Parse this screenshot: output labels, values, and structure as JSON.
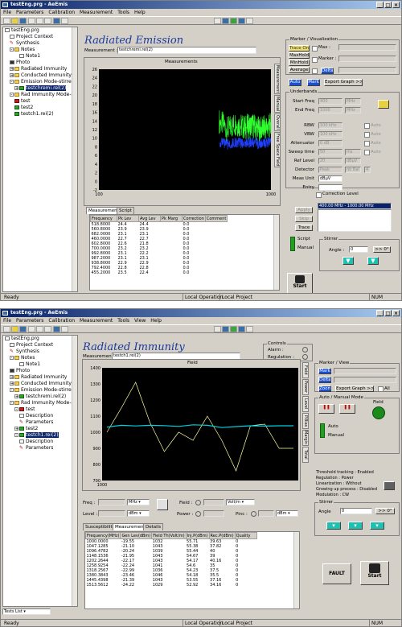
{
  "w1": {
    "title": "testEng.prg - AeEmis",
    "menu": [
      "File",
      "Parameters",
      "Calibration",
      "Measurement",
      "Tools",
      "Help"
    ],
    "tree": [
      {
        "label": "testEng.prg",
        "icon": "doc",
        "indent": 0,
        "pm": ""
      },
      {
        "label": "Project Context",
        "icon": "doc",
        "indent": 1,
        "pm": ""
      },
      {
        "label": "Synthesis",
        "icon": "pin",
        "indent": 1,
        "pm": ""
      },
      {
        "label": "Notes",
        "icon": "folder",
        "indent": 1,
        "pm": "-"
      },
      {
        "label": "Note1",
        "icon": "doc",
        "indent": 3,
        "pm": ""
      },
      {
        "label": "Photo",
        "icon": "photo",
        "indent": 1,
        "pm": ""
      },
      {
        "label": "Radiated Immunity",
        "icon": "folder",
        "indent": 1,
        "pm": "+"
      },
      {
        "label": "Conducted Immunity",
        "icon": "folder",
        "indent": 1,
        "pm": "+"
      },
      {
        "label": "Emission Mode-stirred Ch",
        "icon": "folder",
        "indent": 1,
        "pm": "-"
      },
      {
        "label": "testchremi.rel(2)",
        "icon": "green",
        "indent": 2,
        "pm": "+",
        "selected": true
      },
      {
        "label": "Rad Immunity Mode-stirred C",
        "icon": "folder",
        "indent": 1,
        "pm": "-"
      },
      {
        "label": "test",
        "icon": "red",
        "indent": 2,
        "pm": ""
      },
      {
        "label": "test2",
        "icon": "green",
        "indent": 2,
        "pm": ""
      },
      {
        "label": "testch1.rei(2)",
        "icon": "green",
        "indent": 2,
        "pm": ""
      }
    ],
    "header": "Radiated Emission",
    "measurement_label": "Measurement :",
    "measurement_value": "testchremi.rel(2)",
    "plot_title": "Measurements",
    "y_ticks": [
      "26",
      "24",
      "22",
      "20",
      "18",
      "16",
      "14",
      "12",
      "10",
      "8",
      "6",
      "4",
      "2",
      "0",
      "-2"
    ],
    "x_ticks": [
      "100",
      "1000"
    ],
    "chart_data": {
      "type": "line",
      "x_scale": "log",
      "xlim": [
        100,
        1000
      ],
      "ylim": [
        -2,
        26
      ],
      "series": [
        {
          "color": "#30ff30",
          "x": [
            500,
            560,
            620,
            700,
            780,
            860,
            940,
            1000
          ],
          "y": [
            14,
            12,
            13.5,
            12.5,
            13,
            12,
            12.5,
            13
          ]
        },
        {
          "color": "#2040ff",
          "x": [
            500,
            560,
            620,
            700,
            780,
            860,
            940,
            1000
          ],
          "y": [
            9,
            8.5,
            9,
            8.8,
            9.2,
            8.6,
            9,
            9.1
          ]
        }
      ]
    },
    "vtabs": [
      "Measurement",
      "Manual",
      "Overall",
      "Free Space Field"
    ],
    "tabs": [
      "Measurement",
      "Script"
    ],
    "table_headers": [
      "Frequency",
      "Pk Lev",
      "Avg Lev",
      "Pk Marg",
      "Correction",
      "Comment"
    ],
    "table_rows": [
      [
        "518.8000",
        "24.4",
        "24.4",
        "",
        "0.0",
        ""
      ],
      [
        "560.8000",
        "23.9",
        "23.9",
        "",
        "0.0",
        ""
      ],
      [
        "682.0000",
        "23.1",
        "23.1",
        "",
        "0.0",
        ""
      ],
      [
        "460.0000",
        "22.7",
        "22.7",
        "",
        "0.0",
        ""
      ],
      [
        "602.8000",
        "22.6",
        "21.8",
        "",
        "0.0",
        ""
      ],
      [
        "700.0000",
        "23.2",
        "23.2",
        "",
        "0.0",
        ""
      ],
      [
        "992.8000",
        "23.1",
        "22.2",
        "",
        "0.0",
        ""
      ],
      [
        "987.2000",
        "23.1",
        "23.1",
        "",
        "0.0",
        ""
      ],
      [
        "938.8000",
        "22.9",
        "22.9",
        "",
        "0.0",
        ""
      ],
      [
        "792.4000",
        "22.8",
        "22.8",
        "",
        "0.0",
        ""
      ],
      [
        "455.2000",
        "23.5",
        "22.4",
        "",
        "0.0",
        ""
      ]
    ],
    "marker_group": "Marker / Visualization",
    "trace_on": "Trace On",
    "maxhold": "MaxHold",
    "minhold": "MinHold",
    "average": "Average",
    "delta": "Delta",
    "max_lbl": "Max :",
    "marker_lbl": "Marker :",
    "auto_btn": "Auto",
    "mark_btn": "Mark",
    "export_btn": "Export Graph >>",
    "underbands": "Underbands",
    "params": [
      {
        "label": "Start Freq",
        "value": "400",
        "unit": "MHz",
        "auto": false
      },
      {
        "label": "End Freq",
        "value": "1000",
        "unit": "MHz",
        "auto": false
      },
      {
        "label": "RBW",
        "value": "100 kHz",
        "unit": "",
        "auto": true
      },
      {
        "label": "VBW",
        "value": "100 kHz",
        "unit": "",
        "auto": true
      },
      {
        "label": "Attenuator",
        "value": "0 dB",
        "unit": "",
        "auto": true
      },
      {
        "label": "Sweep time",
        "value": "50",
        "unit": "ms",
        "auto": true
      },
      {
        "label": "Ref Level",
        "value": "20",
        "unit": "dBµV",
        "auto": false
      },
      {
        "label": "Detector",
        "value": "Peak",
        "unit": "nb Bal",
        "auto": false
      },
      {
        "label": "Meas Unit",
        "value": "dBµV",
        "unit": "",
        "auto": false
      },
      {
        "label": "Entry",
        "value": "",
        "unit": "",
        "auto": false
      }
    ],
    "auto_lbl": "Auto",
    "nb_value": "4",
    "correction_level": "Correction Level",
    "list_item": "400.00 MHz - 1000.00 MHz",
    "apply_btn": "Apply",
    "skip_btn": "Skip",
    "trace_btn": "Trace",
    "script_lbl": "Script",
    "manual_lbl": "Manual",
    "stirrer": "Stirrer",
    "angle_lbl": "Angle :",
    "angle_val": "0",
    "zero_btn": ">> 0°",
    "start_btn": "Start",
    "status_ready": "Ready",
    "status_local_op": "Local Operation",
    "status_local_proj": "Local Project",
    "status_num": "NUM"
  },
  "w2": {
    "title": "testEng.prg - AeEmis",
    "menu": [
      "File",
      "Parameters",
      "Calibration",
      "Measurement",
      "Tools",
      "View",
      "Help"
    ],
    "tree": [
      {
        "label": "testEng.prg",
        "icon": "doc",
        "indent": 0,
        "pm": ""
      },
      {
        "label": "Project Context",
        "icon": "doc",
        "indent": 1,
        "pm": ""
      },
      {
        "label": "Synthesis",
        "icon": "pin",
        "indent": 1,
        "pm": ""
      },
      {
        "label": "Notes",
        "icon": "folder",
        "indent": 1,
        "pm": "-"
      },
      {
        "label": "Note1",
        "icon": "doc",
        "indent": 3,
        "pm": ""
      },
      {
        "label": "Photo",
        "icon": "photo",
        "indent": 1,
        "pm": ""
      },
      {
        "label": "Radiated Immunity",
        "icon": "folder",
        "indent": 1,
        "pm": "+"
      },
      {
        "label": "Conducted Immunity",
        "icon": "folder",
        "indent": 1,
        "pm": "+"
      },
      {
        "label": "Emission Mode-stirred Ch",
        "icon": "folder",
        "indent": 1,
        "pm": "-"
      },
      {
        "label": "testchremi.rel(2)",
        "icon": "green",
        "indent": 2,
        "pm": "+"
      },
      {
        "label": "Rad Immunity Mode-stirred C",
        "icon": "folder",
        "indent": 1,
        "pm": "-"
      },
      {
        "label": "test",
        "icon": "red",
        "indent": 2,
        "pm": "-"
      },
      {
        "label": "Description",
        "icon": "doc",
        "indent": 3,
        "pm": ""
      },
      {
        "label": "Parameters",
        "icon": "pin",
        "indent": 3,
        "pm": ""
      },
      {
        "label": "test2",
        "icon": "green",
        "indent": 2,
        "pm": "+"
      },
      {
        "label": "testch1.rei(2)",
        "icon": "green",
        "indent": 2,
        "pm": "-",
        "selected": true
      },
      {
        "label": "Description",
        "icon": "doc",
        "indent": 3,
        "pm": ""
      },
      {
        "label": "Parameters",
        "icon": "pin",
        "indent": 3,
        "pm": ""
      }
    ],
    "tests_list": "Tests List",
    "header": "Radiated Immunity",
    "measurement_label": "Measurement :",
    "measurement_value": "testch1.rei(2)",
    "controls": "Controls",
    "alarm_lbl": "Alarm :",
    "regulation_lbl": "Regulation :",
    "plot_title": "Field",
    "y_ticks": [
      "1400",
      "1300",
      "1200",
      "1100",
      "1000",
      "900",
      "800",
      "700"
    ],
    "x_ticks": [
      "1000"
    ],
    "chart_data": {
      "type": "line",
      "ylim": [
        700,
        1400
      ],
      "series": [
        {
          "name": "",
          "color": "#ffffa0",
          "values": [
            1000,
            1150,
            1310,
            1060,
            880,
            1000,
            950,
            1100,
            950,
            760,
            1040,
            1050,
            900,
            900
          ]
        },
        {
          "name": "",
          "color": "#00d0e0",
          "values": [
            1032,
            1043,
            1039,
            1043,
            1041,
            1036,
            1046,
            1043,
            1029,
            1035,
            1040,
            1038,
            1040,
            1040
          ]
        }
      ]
    },
    "vtabs": [
      "Field",
      "Power",
      "Level",
      "P.Bias",
      "Margin",
      "Total"
    ],
    "freq_lbl": "Freq :",
    "freq_unit": "MHz",
    "field_lbl": "Field :",
    "field_unit": "Volt/m",
    "level_lbl": "Level :",
    "level_unit": "dBm",
    "power_lbl": "Power :",
    "pinc_lbl": "Pinc :",
    "pinc_unit": "dBm",
    "tabs": [
      "Susceptibility",
      "Measurement",
      "Details"
    ],
    "table_headers": [
      "Frequency(MHz)",
      "Gen Lev(dBm)",
      "Field Th(Volt/m)",
      "Inj.P(dBm)",
      "Rec.P(dBm)",
      "Quality"
    ],
    "table_rows": [
      [
        "1000.0000",
        "-19.55",
        "1032",
        "55.71",
        "39.63",
        "0"
      ],
      [
        "1047.1285",
        "-21.10",
        "1043",
        "55.38",
        "37.82",
        "0"
      ],
      [
        "1096.4782",
        "-20.24",
        "1039",
        "55.44",
        "40",
        "0"
      ],
      [
        "1148.1536",
        "-21.95",
        "1043",
        "54.67",
        "39",
        "0"
      ],
      [
        "1202.2644",
        "-22.17",
        "1043",
        "54.17",
        "40.16",
        "0"
      ],
      [
        "1258.9254",
        "-22.24",
        "1041",
        "54.6",
        "35",
        "0"
      ],
      [
        "1318.2567",
        "-22.99",
        "1036",
        "54.23",
        "37.5",
        "0"
      ],
      [
        "1380.3843",
        "-23.46",
        "1046",
        "54.18",
        "35.5",
        "0"
      ],
      [
        "1445.4398",
        "-21.39",
        "1043",
        "53.55",
        "37.16",
        "0"
      ],
      [
        "1513.5612",
        "-24.22",
        "1029",
        "52.92",
        "34.16",
        "0"
      ]
    ],
    "marker_group": "Marker / View",
    "mark_btn": "Mark",
    "delta_btn": "Delta",
    "zoom_btn": "Zoom",
    "export_btn": "Export Graph >>",
    "all_lbl": "All",
    "mode_group": "Auto / Manual Mode",
    "auto_lbl": "Auto",
    "manual_lbl": "Manual",
    "field_lbl2": "Field",
    "info_lines": [
      "Threshold tracking : Enabled",
      "Regulation : Power",
      "Linearization : Without",
      "Growing up process : Disabled",
      "Modulation : CW"
    ],
    "stirrer": "Stirrer",
    "angle_lbl": "Angle",
    "angle_val": "0",
    "zero_btn": ">> 0°",
    "fault_btn": "FAULT",
    "start_btn": "Start",
    "status_ready": "Ready",
    "status_local_op": "Local Operation",
    "status_local_proj": "Local Project",
    "status_num": "NUM"
  }
}
